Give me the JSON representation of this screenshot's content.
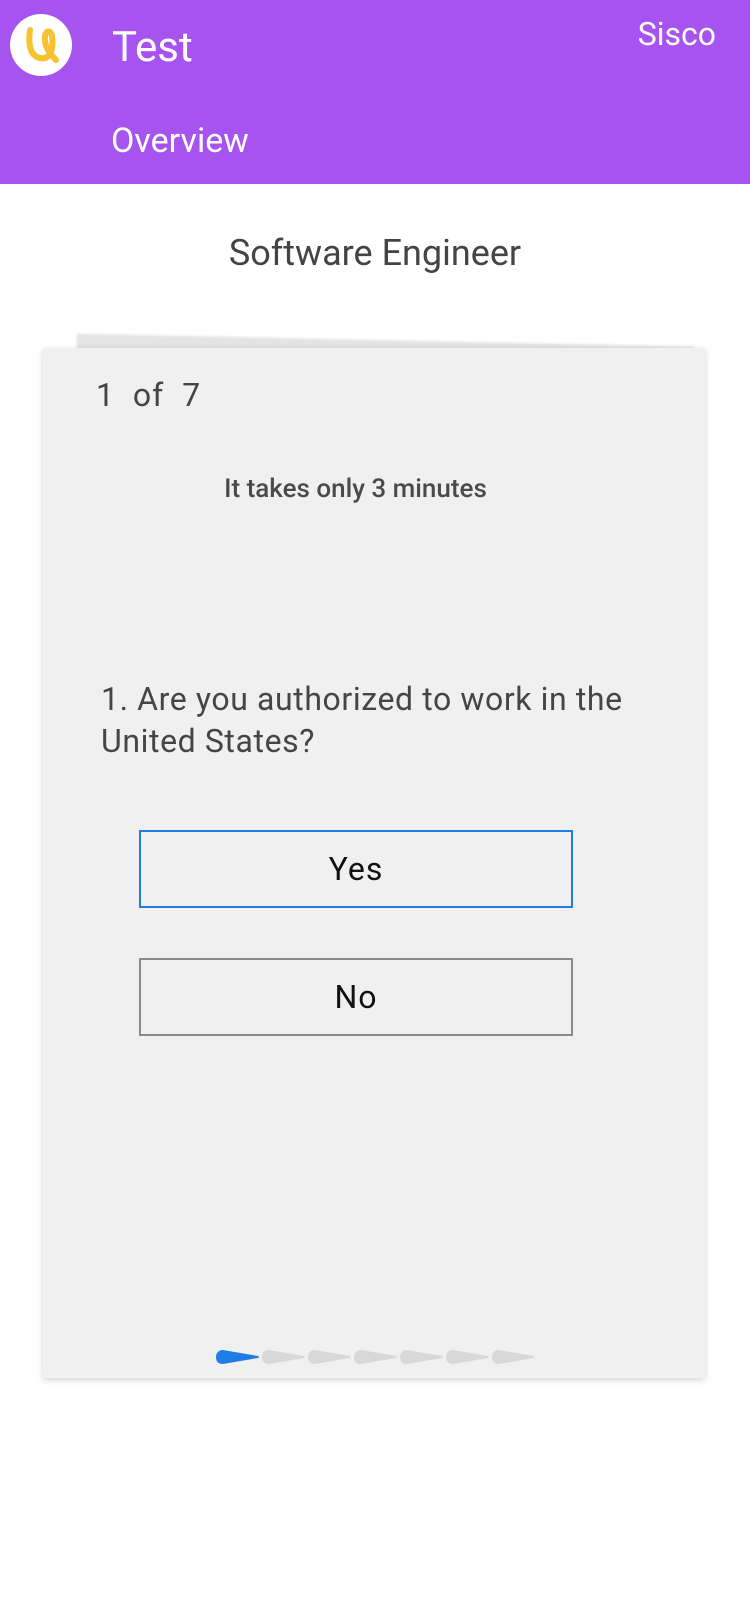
{
  "theme": {
    "brand": "#a653f0",
    "accent": "#1e7ee6",
    "logo_color": "#f6c22d",
    "dot_inactive": "#d8d8d8"
  },
  "header": {
    "logo_icon": "app-logo-icon",
    "app_title": "Test",
    "company": "Sisco",
    "tab_label": "Overview"
  },
  "job": {
    "title": "Software Engineer"
  },
  "quiz": {
    "counter": "1  of  7",
    "current": 1,
    "total": 7,
    "duration_text": "It takes only 3 minutes",
    "question": "1. Are you authorized to work in the United States?",
    "options": [
      {
        "label": "Yes",
        "selected": true
      },
      {
        "label": "No",
        "selected": false
      }
    ]
  }
}
